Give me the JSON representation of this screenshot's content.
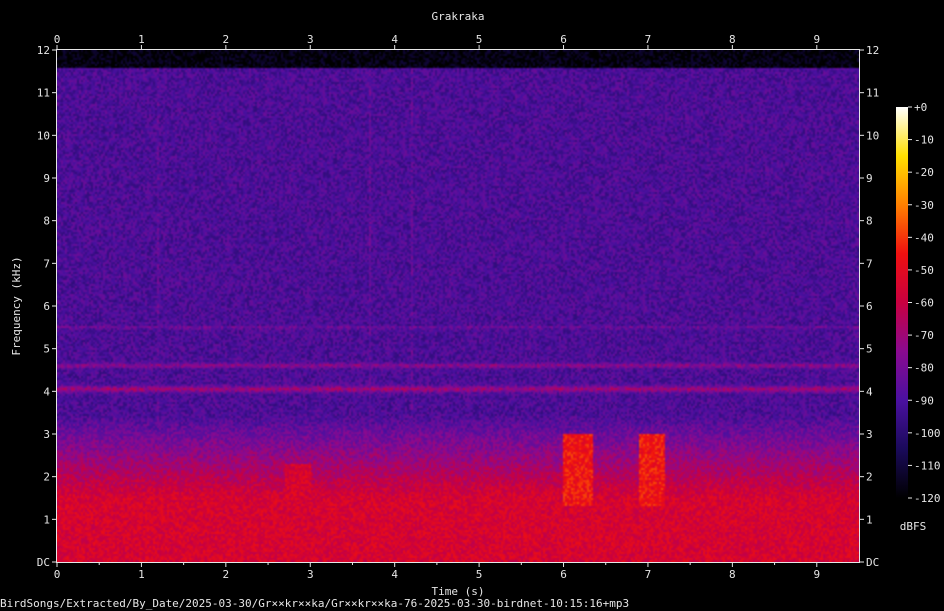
{
  "chart_data": {
    "type": "heatmap",
    "title": "Grakraka",
    "xlabel": "Time (s)",
    "ylabel": "Frequency (kHz)",
    "xlim": [
      0,
      9.5
    ],
    "ylim": [
      0,
      12
    ],
    "x_ticks": [
      0,
      1,
      2,
      3,
      4,
      5,
      6,
      7,
      8,
      9
    ],
    "y_tick_labels": [
      "DC",
      "1",
      "2",
      "3",
      "4",
      "5",
      "6",
      "7",
      "8",
      "9",
      "10",
      "11",
      "12"
    ],
    "colorbar": {
      "unit": "dBFS",
      "range": [
        -120,
        0
      ],
      "tick_labels": [
        "+0",
        "-10",
        "-20",
        "-30",
        "-40",
        "-50",
        "-60",
        "-70",
        "-80",
        "-90",
        "-100",
        "-110",
        "-120"
      ],
      "colormap": [
        "#000000",
        "#1a0a5a",
        "#4a10a0",
        "#8a0a90",
        "#c80040",
        "#f01010",
        "#ff8000",
        "#ffe000",
        "#ffffff"
      ]
    },
    "background_level_dbfs": -95,
    "low_freq_band": {
      "freq_khz": [
        0,
        1.5
      ],
      "level_dbfs": -55
    },
    "horizontal_bands": [
      {
        "freq_khz": 4.6,
        "level_dbfs": -75
      },
      {
        "freq_khz": 5.5,
        "level_dbfs": -82
      },
      {
        "freq_khz": 4.05,
        "level_dbfs": -70
      }
    ],
    "vertical_lines": [
      {
        "time_s": 1.2,
        "level_dbfs": -85
      },
      {
        "time_s": 3.7,
        "level_dbfs": -85
      },
      {
        "time_s": 4.2,
        "level_dbfs": -85
      }
    ],
    "calls": [
      {
        "time_s": [
          2.7,
          3.0
        ],
        "freq_khz": [
          1.4,
          2.3
        ],
        "level_dbfs": -55
      },
      {
        "time_s": [
          6.0,
          6.35
        ],
        "freq_khz": [
          1.3,
          3.0
        ],
        "level_dbfs": -45
      },
      {
        "time_s": [
          6.9,
          7.2
        ],
        "freq_khz": [
          1.3,
          3.0
        ],
        "level_dbfs": -45
      }
    ]
  },
  "footer": {
    "file_path": "BirdSongs/Extracted/By_Date/2025-03-30/Gr××kr××ka/Gr××kr××ka-76-2025-03-30-birdnet-10:15:16+mp3"
  }
}
